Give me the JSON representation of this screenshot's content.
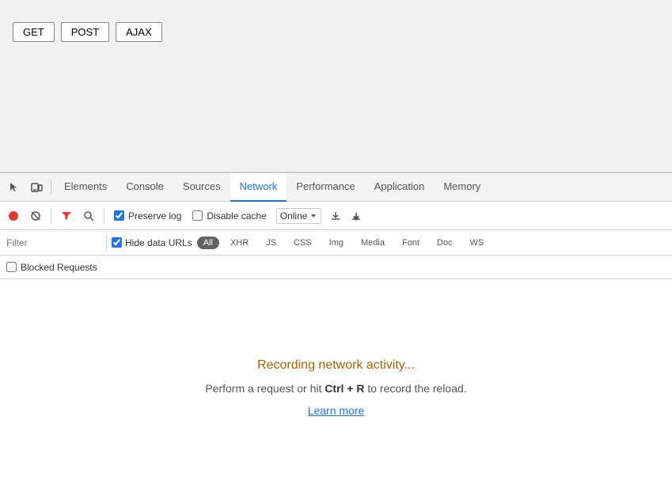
{
  "buttons": {
    "get": "GET",
    "post": "POST",
    "ajax": "AJAX"
  },
  "tabs": {
    "items": [
      {
        "id": "elements",
        "label": "Elements",
        "active": false
      },
      {
        "id": "console",
        "label": "Console",
        "active": false
      },
      {
        "id": "sources",
        "label": "Sources",
        "active": false
      },
      {
        "id": "network",
        "label": "Network",
        "active": true
      },
      {
        "id": "performance",
        "label": "Performance",
        "active": false
      },
      {
        "id": "application",
        "label": "Application",
        "active": false
      },
      {
        "id": "memory",
        "label": "Memory",
        "active": false
      }
    ]
  },
  "toolbar": {
    "preserve_log_label": "Preserve log",
    "disable_cache_label": "Disable cache",
    "online_label": "Online"
  },
  "filter": {
    "placeholder": "Filter",
    "hide_data_urls_label": "Hide data URLs",
    "chips": [
      "All",
      "XHR",
      "JS",
      "CSS",
      "Img",
      "Media",
      "Font",
      "Doc",
      "WS"
    ]
  },
  "blocked": {
    "label": "Blocked Requests"
  },
  "main": {
    "recording_text": "Recording network activity...",
    "perform_text": "Perform a request or hit ",
    "ctrl_r": "Ctrl + R",
    "to_record": " to record the reload.",
    "learn_more": "Learn more"
  },
  "colors": {
    "active_tab": "#1a73e8",
    "record_red": "#e53935",
    "recording_text": "#b06000"
  }
}
